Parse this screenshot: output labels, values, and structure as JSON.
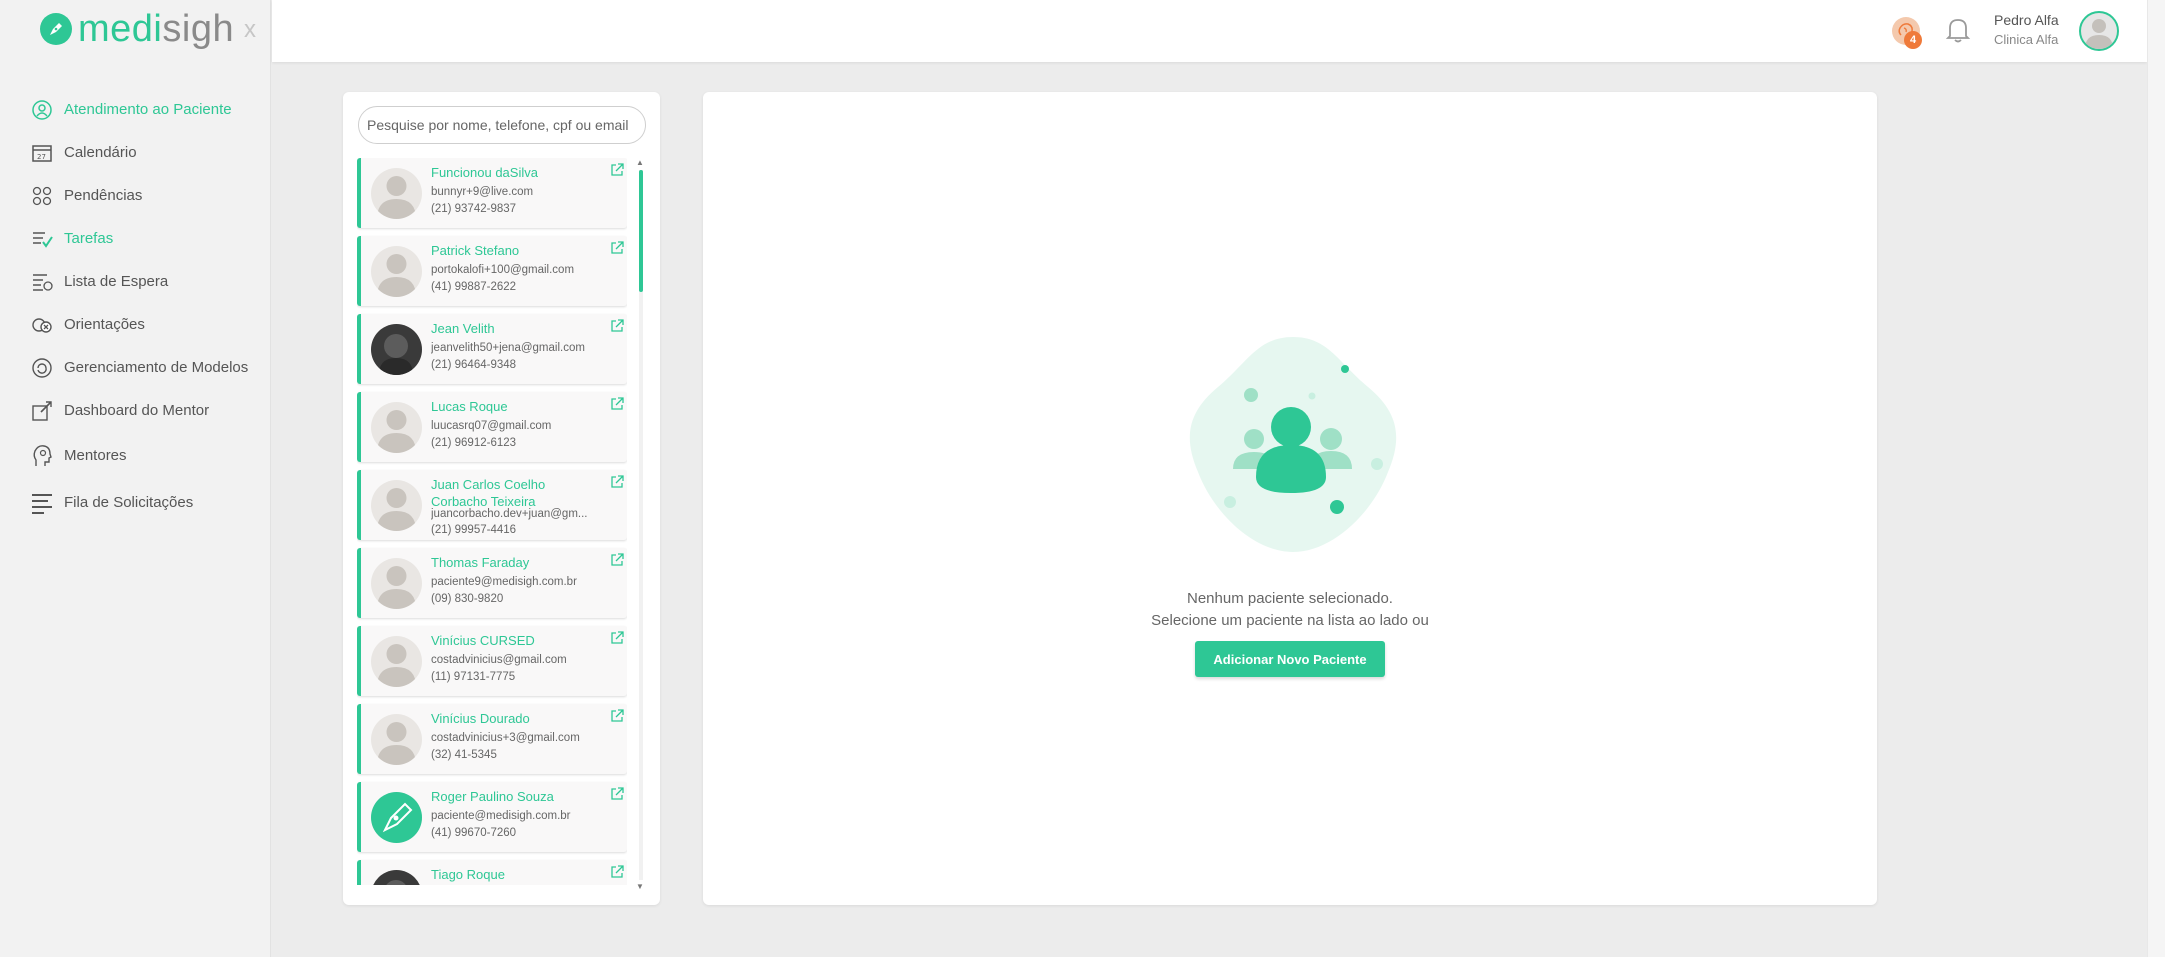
{
  "brand": {
    "logo_accent": "medi",
    "logo_rest": "sigh",
    "close_label": "x"
  },
  "colors": {
    "accent": "#2ec795",
    "notify": "#ef7a3a"
  },
  "sidebar": {
    "items": [
      {
        "label": "Atendimento ao Paciente",
        "icon": "patient-care-icon",
        "active": true
      },
      {
        "label": "Calendário",
        "icon": "calendar-icon",
        "active": false
      },
      {
        "label": "Pendências",
        "icon": "pending-icon",
        "active": false
      },
      {
        "label": "Tarefas",
        "icon": "tasks-icon",
        "active": true
      },
      {
        "label": "Lista de Espera",
        "icon": "waitlist-icon",
        "active": false
      },
      {
        "label": "Orientações",
        "icon": "guidance-icon",
        "active": false
      },
      {
        "label": "Gerenciamento de Modelos",
        "icon": "templates-icon",
        "active": false
      },
      {
        "label": "Dashboard do Mentor",
        "icon": "dashboard-icon",
        "active": false
      },
      {
        "label": "Mentores",
        "icon": "mentor-icon",
        "active": false
      },
      {
        "label": "Fila de Solicitações",
        "icon": "queue-icon",
        "active": false
      }
    ]
  },
  "header": {
    "brain_badge_count": "4",
    "user_name": "Pedro Alfa",
    "clinic_name": "Clinica Alfa"
  },
  "search": {
    "placeholder": "Pesquise por nome, telefone, cpf ou email"
  },
  "patients": [
    {
      "name": "Funcionou daSilva",
      "email": "bunnyr+9@live.com",
      "phone": "(21) 93742-9837",
      "avatar": "default"
    },
    {
      "name": "Patrick Stefano",
      "email": "portokalofi+100@gmail.com",
      "phone": "(41) 99887-2622",
      "avatar": "default"
    },
    {
      "name": "Jean Velith",
      "email": "jeanvelith50+jena@gmail.com",
      "phone": "(21) 96464-9348",
      "avatar": "photo"
    },
    {
      "name": "Lucas Roque",
      "email": "luucasrq07@gmail.com",
      "phone": "(21) 96912-6123",
      "avatar": "default"
    },
    {
      "name": "Juan Carlos Coelho Corbacho Teixeira",
      "email": "juancorbacho.dev+juan@gm...",
      "phone": "(21) 99957-4416",
      "avatar": "default"
    },
    {
      "name": "Thomas Faraday",
      "email": "paciente9@medisigh.com.br",
      "phone": "(09) 830-9820",
      "avatar": "default"
    },
    {
      "name": "Vinícius CURSED",
      "email": "costadvinicius@gmail.com",
      "phone": "(11) 97131-7775",
      "avatar": "default"
    },
    {
      "name": "Vinícius Dourado",
      "email": "costadvinicius+3@gmail.com",
      "phone": "(32) 41-5345",
      "avatar": "default"
    },
    {
      "name": "Roger Paulino Souza",
      "email": "paciente@medisigh.com.br",
      "phone": "(41) 99670-7260",
      "avatar": "brand"
    },
    {
      "name": "Tiago Roque",
      "email": "",
      "phone": "",
      "avatar": "photo"
    }
  ],
  "empty_state": {
    "line1": "Nenhum paciente selecionado.",
    "line2": "Selecione um paciente na lista ao lado ou",
    "button_label": "Adicionar Novo Paciente"
  }
}
